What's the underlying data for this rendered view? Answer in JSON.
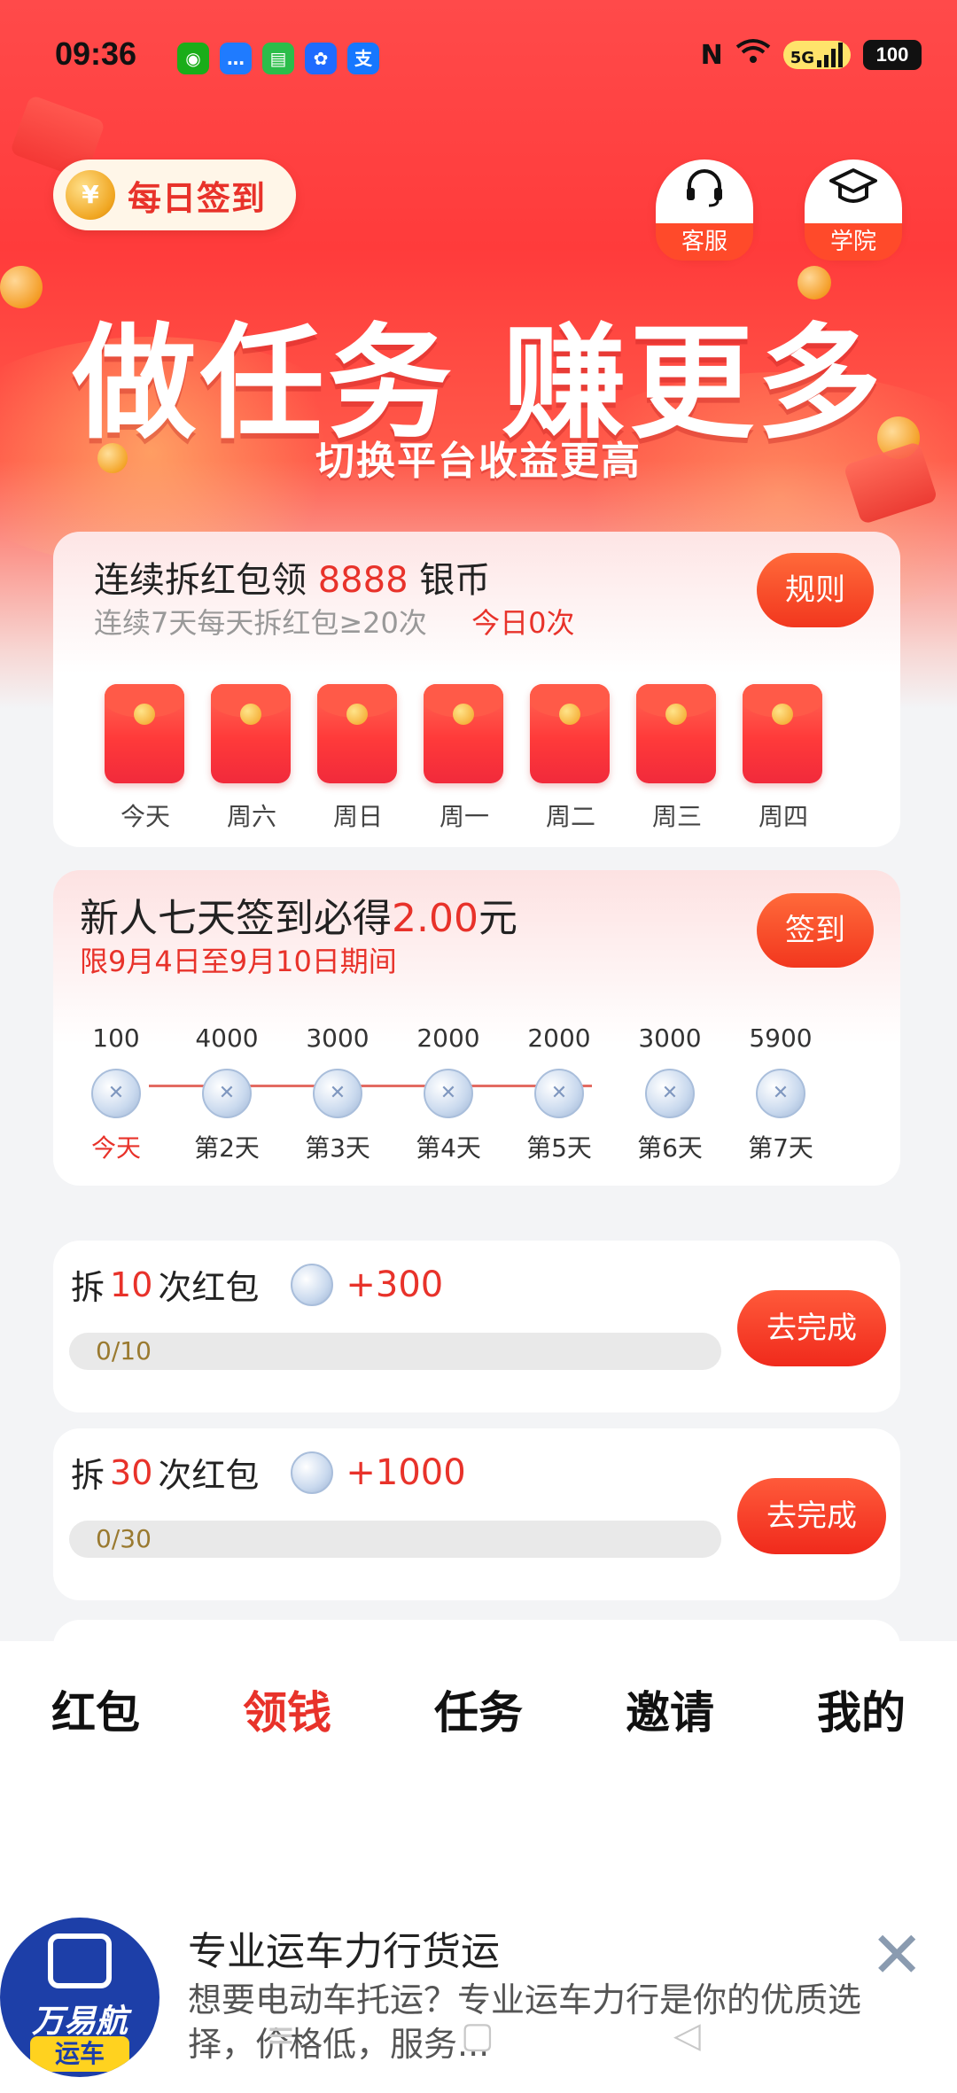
{
  "status_bar": {
    "time": "09:36",
    "notifications": [
      {
        "icon": "wechat-icon",
        "glyph": "◉",
        "color": "#1aad19"
      },
      {
        "icon": "message-icon",
        "glyph": "…",
        "color": "#1f7bff"
      },
      {
        "icon": "sms-icon",
        "glyph": "▤",
        "color": "#2bbd4a"
      },
      {
        "icon": "pinwheel-icon",
        "glyph": "✿",
        "color": "#1f6bff"
      },
      {
        "icon": "alipay-icon",
        "glyph": "支",
        "color": "#1677ff"
      }
    ],
    "nfc": "N",
    "signal_5g": "5G",
    "battery": "100"
  },
  "header": {
    "daily_signin": "每日签到",
    "coin_symbol": "¥",
    "service_label": "客服",
    "academy_label": "学院",
    "slogan": "做任务 赚更多",
    "subslogan": "切换平台收益更高"
  },
  "streak_card": {
    "title_prefix": "连续拆红包领",
    "title_amount": "8888",
    "title_suffix": "银币",
    "subtitle": "连续7天每天拆红包≥20次",
    "today_count": "今日0次",
    "rules_button": "规则",
    "days": [
      "今天",
      "周六",
      "周日",
      "周一",
      "周二",
      "周三",
      "周四"
    ]
  },
  "signin_card": {
    "title_prefix": "新人七天签到必得",
    "title_amount": "2.00",
    "title_suffix": "元",
    "subtitle": "限9月4日至9月10日期间",
    "signin_button": "签到",
    "steps": [
      {
        "amount": "100",
        "label": "今天"
      },
      {
        "amount": "4000",
        "label": "第2天"
      },
      {
        "amount": "3000",
        "label": "第3天"
      },
      {
        "amount": "2000",
        "label": "第4天"
      },
      {
        "amount": "2000",
        "label": "第5天"
      },
      {
        "amount": "3000",
        "label": "第6天"
      },
      {
        "amount": "5900",
        "label": "第7天"
      }
    ]
  },
  "tasks": [
    {
      "prefix": "拆",
      "count": "10",
      "suffix": "次红包",
      "reward": "+300",
      "progress_text": "0/10",
      "progress": 0,
      "button": "去完成"
    },
    {
      "prefix": "拆",
      "count": "30",
      "suffix": "次红包",
      "reward": "+1000",
      "progress_text": "0/30",
      "progress": 0,
      "button": "去完成"
    }
  ],
  "bottom_nav": {
    "items": [
      "红包",
      "领钱",
      "任务",
      "邀请",
      "我的"
    ],
    "active_index": 1
  },
  "ad": {
    "brand": "万易航",
    "brand_tag": "运车",
    "title": "专业运车力行货运",
    "description": "想要电动车托运？专业运车力行是你的优质选择，价格低，服务..."
  },
  "colors": {
    "accent_red": "#e8322a",
    "hero_red": "#ff3b3b",
    "coin_gold": "#f0a520"
  }
}
